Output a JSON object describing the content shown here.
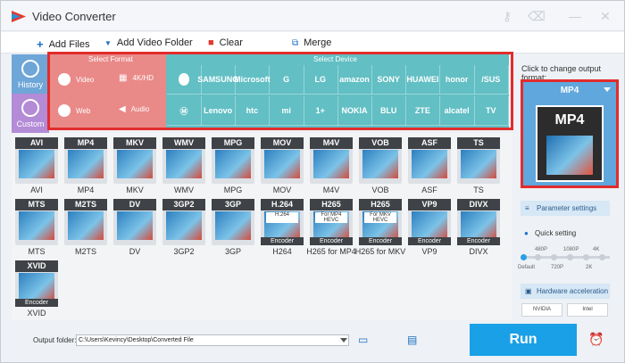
{
  "window": {
    "title": "Video Converter"
  },
  "toolbar": {
    "add_files": "Add Files",
    "add_folder": "Add Video Folder",
    "clear": "Clear",
    "merge": "Merge"
  },
  "side_tabs": {
    "history": "History",
    "custom": "Custom"
  },
  "format_panel": {
    "header": "Select Format",
    "video": "Video",
    "hd": "4K/HD",
    "web": "Web",
    "audio": "Audio"
  },
  "device_panel": {
    "header": "Select Device",
    "row1": [
      "",
      "SAMSUNG",
      "Microsoft",
      "G",
      "LG",
      "amazon",
      "SONY",
      "HUAWEI",
      "honor",
      "/SUS"
    ],
    "row2": [
      "",
      "Lenovo",
      "htc",
      "mi",
      "1+",
      "NOKIA",
      "BLU",
      "ZTE",
      "alcatel",
      "TV"
    ]
  },
  "formats": [
    {
      "name": "AVI",
      "label": "AVI",
      "encoder": ""
    },
    {
      "name": "MP4",
      "label": "MP4",
      "encoder": ""
    },
    {
      "name": "MKV",
      "label": "MKV",
      "encoder": ""
    },
    {
      "name": "WMV",
      "label": "WMV",
      "encoder": ""
    },
    {
      "name": "MPG",
      "label": "MPG",
      "encoder": ""
    },
    {
      "name": "MOV",
      "label": "MOV",
      "encoder": ""
    },
    {
      "name": "M4V",
      "label": "M4V",
      "encoder": ""
    },
    {
      "name": "VOB",
      "label": "VOB",
      "encoder": ""
    },
    {
      "name": "ASF",
      "label": "ASF",
      "encoder": ""
    },
    {
      "name": "TS",
      "label": "TS",
      "encoder": ""
    },
    {
      "name": "MTS",
      "label": "MTS",
      "encoder": ""
    },
    {
      "name": "M2TS",
      "label": "M2TS",
      "encoder": ""
    },
    {
      "name": "DV",
      "label": "DV",
      "encoder": ""
    },
    {
      "name": "3GP2",
      "label": "3GP2",
      "encoder": ""
    },
    {
      "name": "3GP",
      "label": "3GP",
      "encoder": ""
    },
    {
      "name": "H.264",
      "label": "H264",
      "encoder": "Encoder",
      "sub": "H.264"
    },
    {
      "name": "H265",
      "label": "H265 for MP4",
      "encoder": "Encoder",
      "sub": "For MP4 HEVC"
    },
    {
      "name": "H265",
      "label": "H265 for MKV",
      "encoder": "Encoder",
      "sub": "For MKV HEVC"
    },
    {
      "name": "VP9",
      "label": "VP9",
      "encoder": "Encoder"
    },
    {
      "name": "DIVX",
      "label": "DIVX",
      "encoder": "Encoder"
    },
    {
      "name": "XVID",
      "label": "XVID",
      "encoder": "Encoder"
    }
  ],
  "output": {
    "caption": "Click to change output format:",
    "format": "MP4",
    "icon_text": "MP4"
  },
  "settings": {
    "param_label": "Parameter settings",
    "quick_label": "Quick setting",
    "ticks_top": [
      "480P",
      "1080P",
      "4K"
    ],
    "ticks_bottom": [
      "Default",
      "720P",
      "2K"
    ],
    "hw_label": "Hardware acceleration",
    "nvidia": "NVIDIA",
    "intel": "Intel"
  },
  "bottom": {
    "folder_label": "Output folder:",
    "folder_path": "C:\\Users\\Kevincy\\Desktop\\Converted File",
    "run": "Run"
  }
}
